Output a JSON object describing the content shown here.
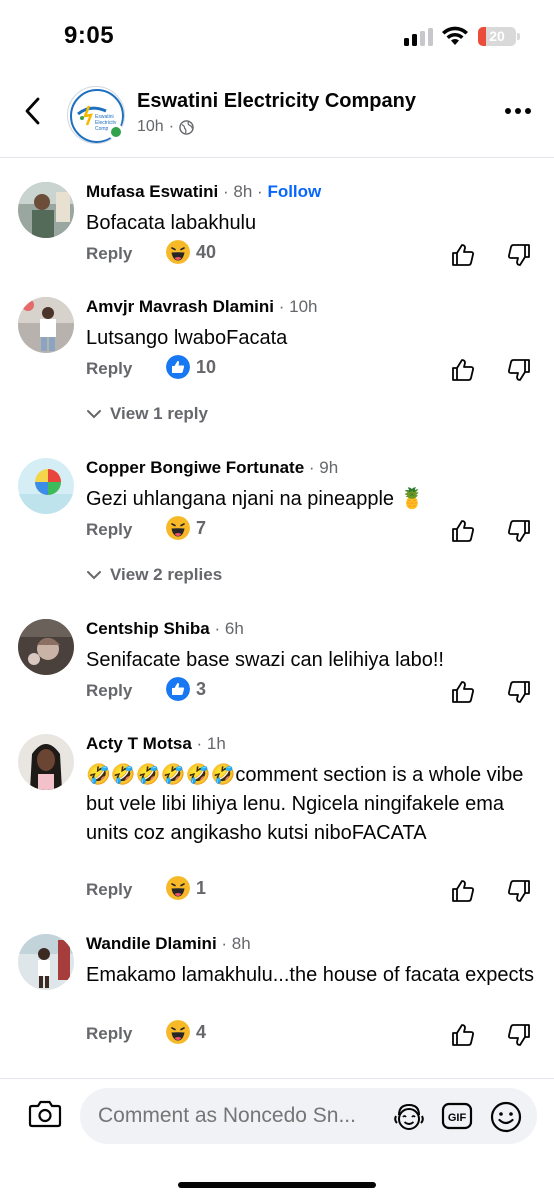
{
  "status_bar": {
    "time": "9:05",
    "battery_level": "20",
    "battery_fraction": 0.2,
    "icons": [
      "cellular-signal-icon",
      "wifi-icon",
      "battery-icon"
    ]
  },
  "header": {
    "page_name": "Eswatini Electricity Company",
    "time_ago": "10h",
    "separator": "·",
    "privacy_icon": "globe-icon",
    "avatar_text": [
      "Eswatini",
      "Electricity",
      "Comp"
    ]
  },
  "comments": [
    {
      "author": "Mufasa Eswatini",
      "time": "8h",
      "follow": "Follow",
      "text": "Bofacata labakhulu",
      "reply_label": "Reply",
      "reaction": "haha",
      "reaction_count": "40"
    },
    {
      "author": "Amvjr Mavrash Dlamini",
      "time": "10h",
      "text": "Lutsango lwaboFacata",
      "reply_label": "Reply",
      "reaction": "like",
      "reaction_count": "10",
      "view_replies": "View 1 reply"
    },
    {
      "author": "Copper Bongiwe Fortunate",
      "time": "9h",
      "text": "Gezi uhlangana njani na pineapple 🍍",
      "reply_label": "Reply",
      "reaction": "haha",
      "reaction_count": "7",
      "view_replies": "View 2 replies"
    },
    {
      "author": "Centship Shiba",
      "time": "6h",
      "text": "Senifacate base swazi can lelihiya labo!!",
      "reply_label": "Reply",
      "reaction": "like",
      "reaction_count": "3"
    },
    {
      "author": "Acty T Motsa",
      "time": "1h",
      "text": "🤣🤣🤣🤣🤣🤣comment section is a whole vibe but vele libi lihiya lenu. Ngicela ningifakele ema units coz angikasho kutsi niboFACATA",
      "reply_label": "Reply",
      "reaction": "haha",
      "reaction_count": "1"
    },
    {
      "author": "Wandile Dlamini",
      "time": "8h",
      "text": "Emakamo lamakhulu...the house of facata expects",
      "reply_label": "Reply",
      "reaction": "haha",
      "reaction_count": "4"
    }
  ],
  "composer": {
    "placeholder": "Comment as Noncedo Sn...",
    "gif_label": "GIF"
  },
  "colors": {
    "link_blue": "#0866ff",
    "secondary_text": "#65676b",
    "haha_yellow": "#f7b928",
    "like_blue": "#1877f2",
    "online_green": "#31a24c",
    "battery_red": "#eb4d3d"
  }
}
